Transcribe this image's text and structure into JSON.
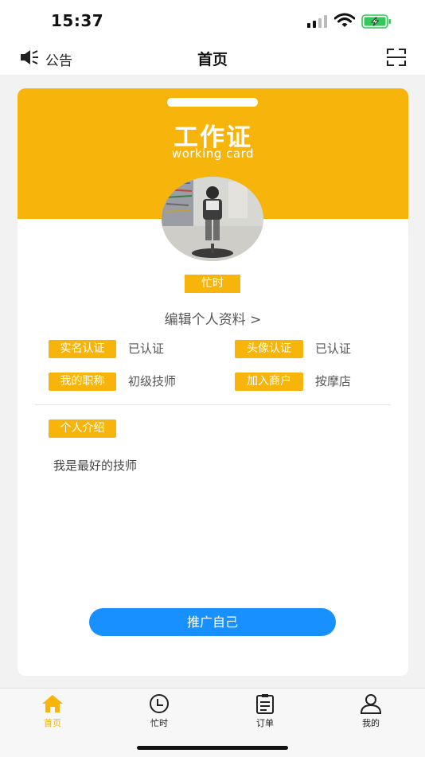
{
  "status_bar": {
    "time": "15:37"
  },
  "nav": {
    "notice_label": "公告",
    "title": "首页"
  },
  "card": {
    "title": "工作证",
    "subtitle": "working card",
    "status_badge": "忙时",
    "edit_profile": "编辑个人资料 >",
    "fields": [
      {
        "tag": "实名认证",
        "value": "已认证"
      },
      {
        "tag": "头像认证",
        "value": "已认证"
      },
      {
        "tag": "我的职称",
        "value": "初级技师"
      },
      {
        "tag": "加入商户",
        "value": "按摩店"
      }
    ],
    "intro_tag": "个人介绍",
    "intro_text": "我是最好的技师",
    "promote_button": "推广自己"
  },
  "tabs": [
    {
      "label": "首页",
      "icon": "home-icon",
      "active": true
    },
    {
      "label": "忙时",
      "icon": "clock-icon",
      "active": false
    },
    {
      "label": "订单",
      "icon": "clipboard-icon",
      "active": false
    },
    {
      "label": "我的",
      "icon": "user-icon",
      "active": false
    }
  ],
  "colors": {
    "accent": "#f7b50c",
    "button": "#1890ff",
    "battery": "#34c759"
  }
}
